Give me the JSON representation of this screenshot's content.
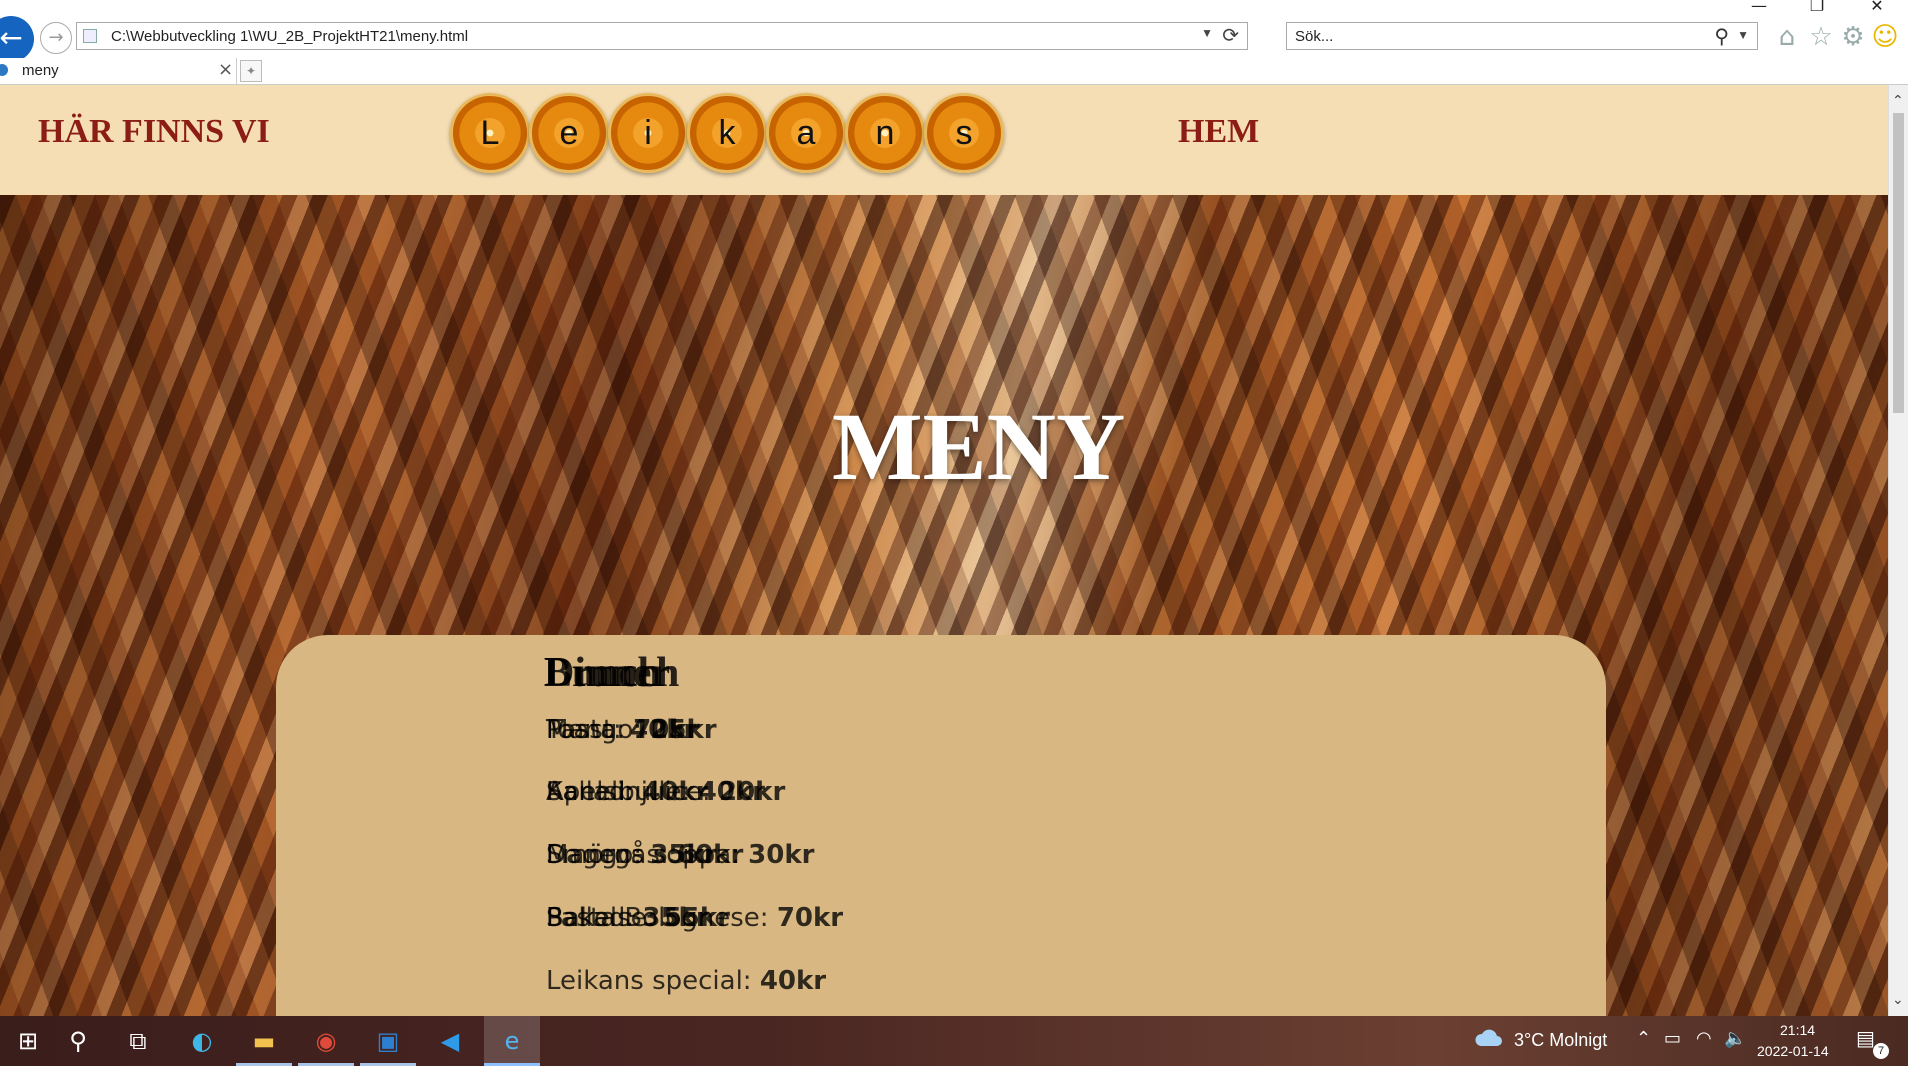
{
  "window": {
    "minimize": "—",
    "restore": "❐",
    "close": "✕"
  },
  "browser": {
    "address": "C:\\Webbutveckling 1\\WU_2B_ProjektHT21\\meny.html",
    "search_placeholder": "Sök...",
    "tab_title": "meny",
    "icons": [
      "back-icon",
      "forward-icon",
      "refresh-icon",
      "search-icon",
      "home-icon",
      "favorites-star-icon",
      "settings-gear-icon",
      "smiley-feedback-icon"
    ]
  },
  "site": {
    "nav_left": "HÄR FINNS VI",
    "nav_right": "HEM",
    "logo_letters": [
      "L",
      "e",
      "i",
      "k",
      "a",
      "n",
      "s"
    ],
    "hero_title": "MENY",
    "menu_headings": [
      "Brunch",
      "Lunch",
      "Dinner"
    ],
    "menu_rows": [
      [
        {
          "label": "Toast: ",
          "price": "40kr"
        },
        {
          "label": "Mango: ",
          "price": "25kr"
        },
        {
          "label": "Pasta: ",
          "price": "70kr"
        }
      ],
      [
        {
          "label": "Apelsinjuice: ",
          "price": "20kr"
        },
        {
          "label": "Kanelbulle: ",
          "price": "40kr"
        },
        {
          "label": "Sallad: ",
          "price": "40kr"
        }
      ],
      [
        {
          "label": "Mango: ",
          "price": "35kr"
        },
        {
          "label": "Dagens soppa: ",
          "price": "30kr"
        },
        {
          "label": "Smörgås: ",
          "price": "60kr"
        }
      ],
      [
        {
          "label": "Pasta Bolognese: ",
          "price": "70kr"
        },
        {
          "label": "Sallad: ",
          "price": "35kr"
        },
        {
          "label": "Bakelse: ",
          "price": "55kr"
        }
      ],
      [
        {
          "label": "Leikans special: ",
          "price": "40kr"
        }
      ]
    ]
  },
  "taskbar": {
    "weather": "3°C  Molnigt",
    "time": "21:14",
    "date": "2022-01-14",
    "notifications": "7",
    "apps": [
      "windows-start-icon",
      "search-icon",
      "task-view-icon",
      "edge-icon",
      "file-explorer-icon",
      "chrome-icon",
      "photos-icon",
      "vscode-icon",
      "internet-explorer-icon"
    ]
  },
  "colors": {
    "header_bg": "#f5ddb4",
    "nav_text": "#8b1d16",
    "card_bg": "#d8b783",
    "browser_blue": "#1565c0"
  }
}
